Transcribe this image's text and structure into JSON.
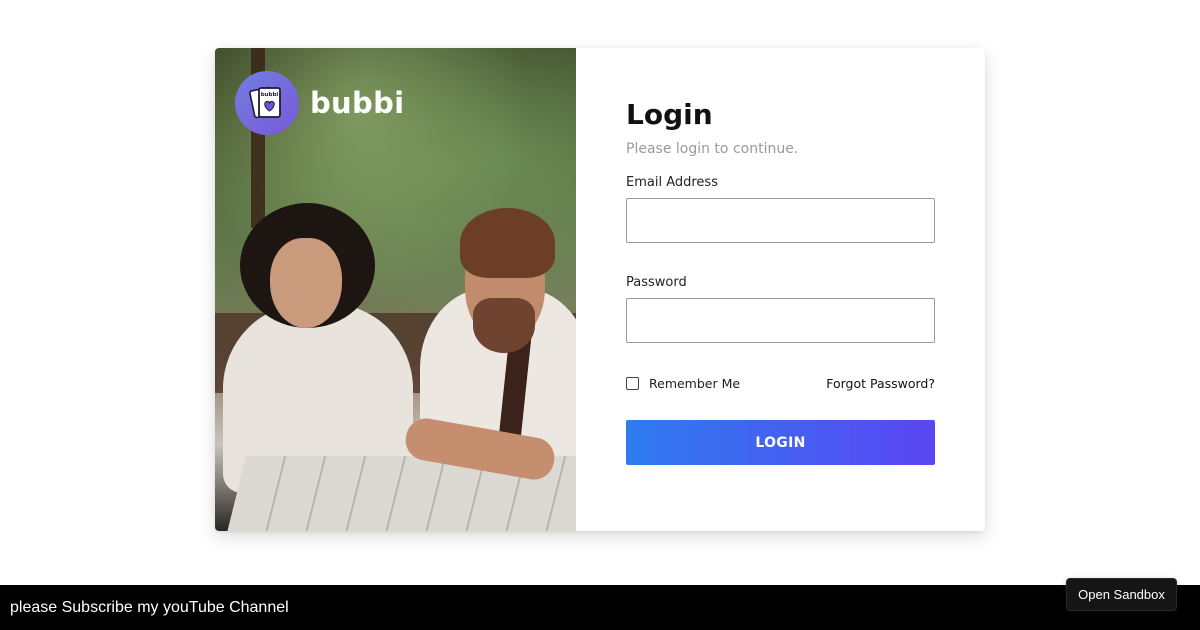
{
  "brand": {
    "name": "bubbi",
    "logo_text": "bubbi",
    "logo_colors": [
      "#6f7fe0",
      "#7a58d8"
    ]
  },
  "login": {
    "title": "Login",
    "subtitle": "Please login to continue.",
    "email_label": "Email Address",
    "email_value": "",
    "password_label": "Password",
    "password_value": "",
    "remember_label": "Remember Me",
    "remember_checked": false,
    "forgot_label": "Forgot Password?",
    "button_label": "LOGIN",
    "button_gradient": [
      "#2e7cf0",
      "#5a46f2"
    ]
  },
  "footer": {
    "text": "please Subscribe my youTube Channel",
    "sandbox_label": "Open Sandbox"
  }
}
